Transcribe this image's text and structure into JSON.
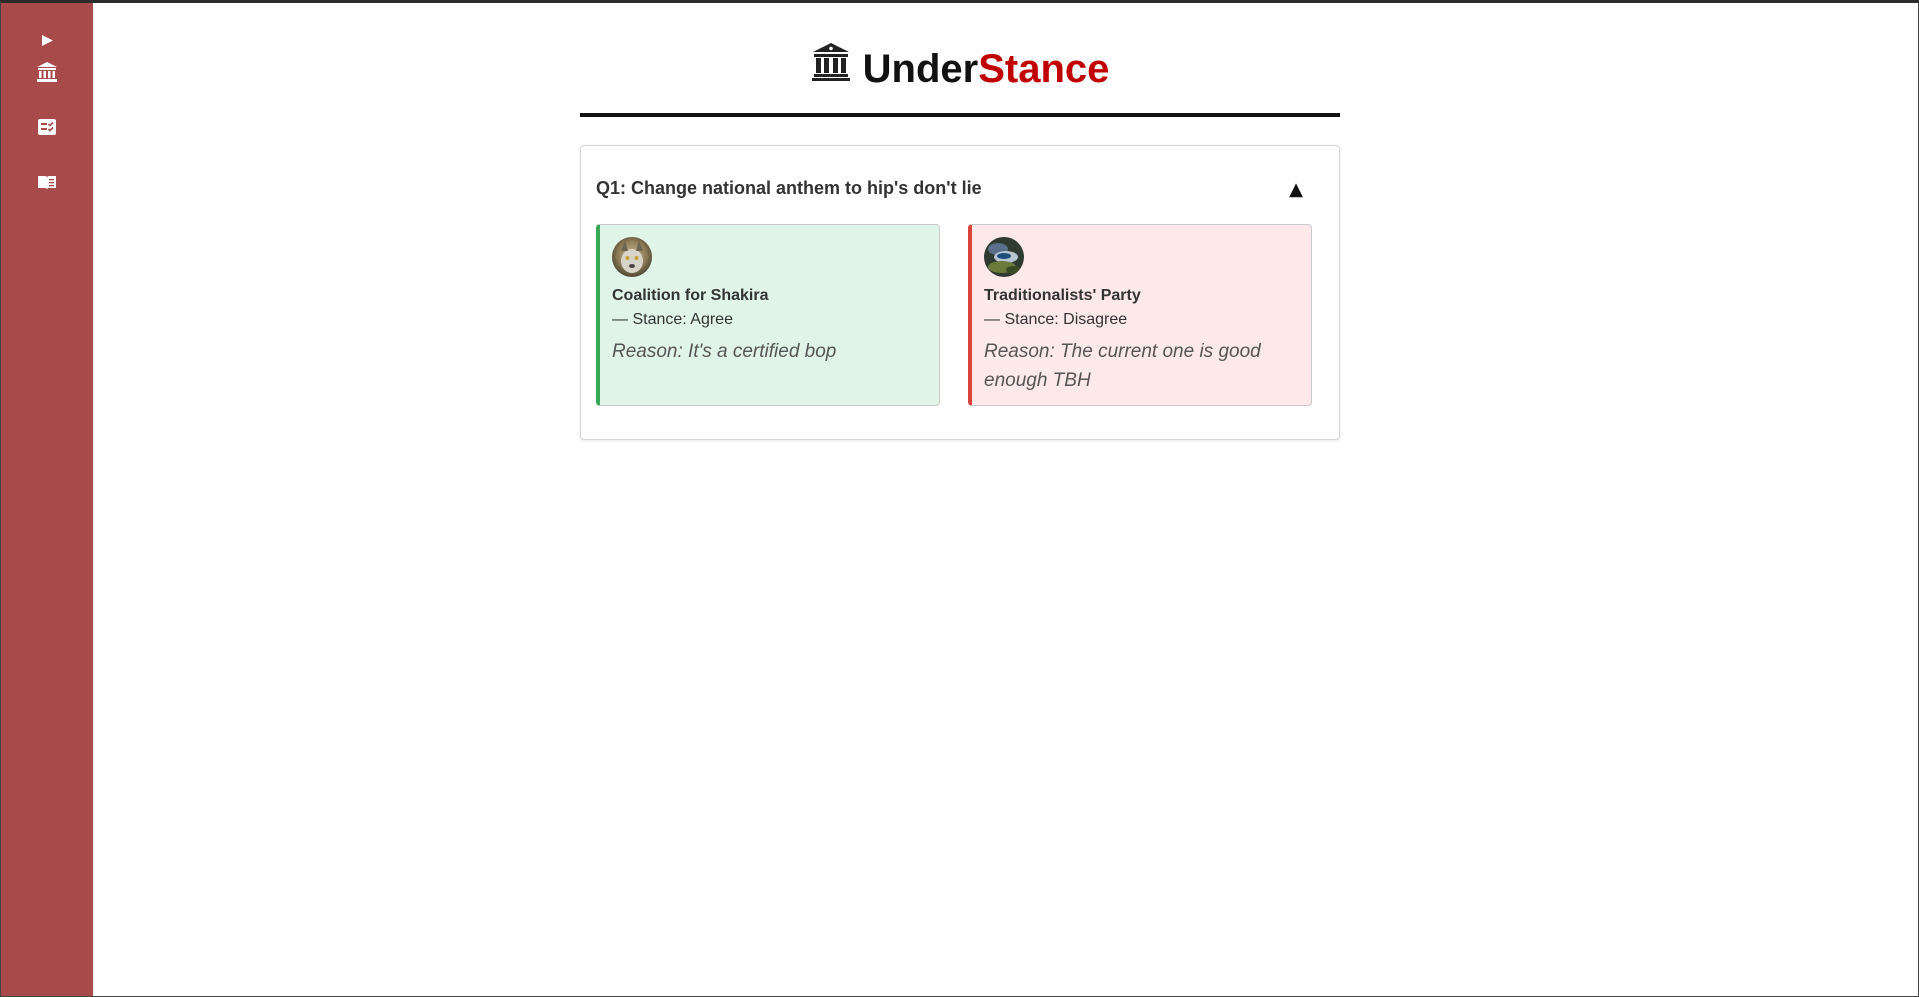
{
  "sidebar": {
    "items": [
      {
        "name": "expand-toggle",
        "icon": "play-triangle-icon"
      },
      {
        "name": "parliament",
        "icon": "bank-icon"
      },
      {
        "name": "checklist",
        "icon": "checklist-icon"
      },
      {
        "name": "reader",
        "icon": "book-icon"
      }
    ],
    "color": "#a84a4a"
  },
  "header": {
    "brand_part1": "Under",
    "brand_part2": "Stance",
    "accent_color": "#c00000",
    "logo_icon": "bank-icon"
  },
  "question": {
    "title": "Q1: Change national anthem to hip's don't lie",
    "toggle_symbol": "▲",
    "parties": [
      {
        "name": "Coalition for Shakira",
        "stance": "— Stance: Agree",
        "reason": "Reason: It's a certified bop",
        "color": "#3aa757"
      },
      {
        "name": "Traditionalists' Party",
        "stance": "— Stance: Disagree",
        "reason": "Reason: The current one is good enough TBH",
        "color": "#d9443b"
      }
    ]
  }
}
